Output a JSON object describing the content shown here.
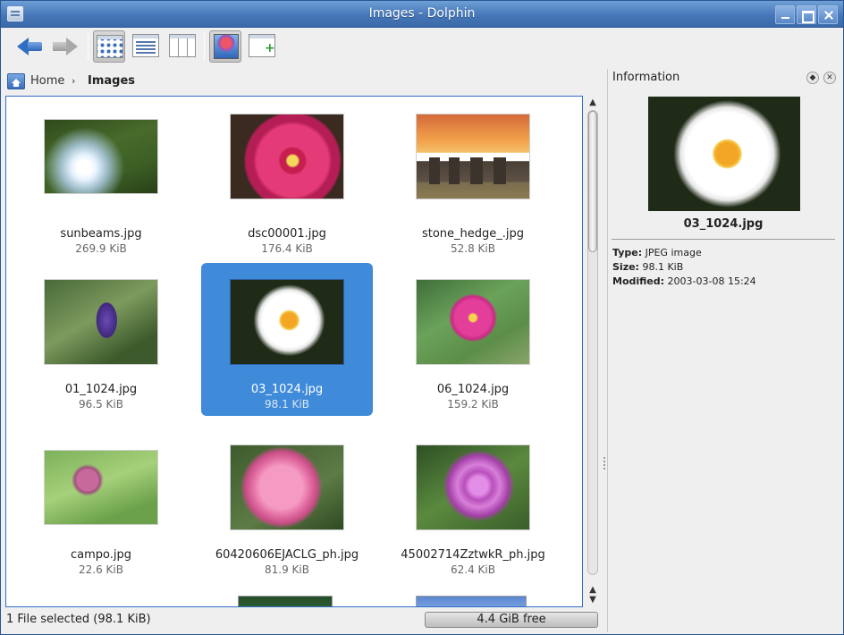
{
  "window": {
    "title": "Images - Dolphin"
  },
  "breadcrumb": {
    "home": "Home",
    "separator": "›",
    "current": "Images"
  },
  "files": [
    {
      "name": "sunbeams.jpg",
      "size": "269.9 KiB"
    },
    {
      "name": "dsc00001.jpg",
      "size": "176.4 KiB"
    },
    {
      "name": "stone_hedge_.jpg",
      "size": "52.8 KiB"
    },
    {
      "name": "01_1024.jpg",
      "size": "96.5 KiB"
    },
    {
      "name": "03_1024.jpg",
      "size": "98.1 KiB",
      "selected": true
    },
    {
      "name": "06_1024.jpg",
      "size": "159.2 KiB"
    },
    {
      "name": "campo.jpg",
      "size": "22.6 KiB"
    },
    {
      "name": "60420606EJACLG_ph.jpg",
      "size": "81.9 KiB"
    },
    {
      "name": "45002714ZztwkR_ph.jpg",
      "size": "62.4 KiB"
    }
  ],
  "info_panel": {
    "title": "Information",
    "filename": "03_1024.jpg",
    "type_label": "Type:",
    "type_value": "JPEG image",
    "size_label": "Size:",
    "size_value": "98.1 KiB",
    "modified_label": "Modified:",
    "modified_value": "2003-03-08 15:24"
  },
  "status": {
    "text": "1 File selected (98.1 KiB)",
    "free_space": "4.4 GiB free"
  },
  "colors": {
    "selection": "#3f8ad9",
    "titlebar": "#4677b8",
    "view_border": "#2f6fc8"
  }
}
